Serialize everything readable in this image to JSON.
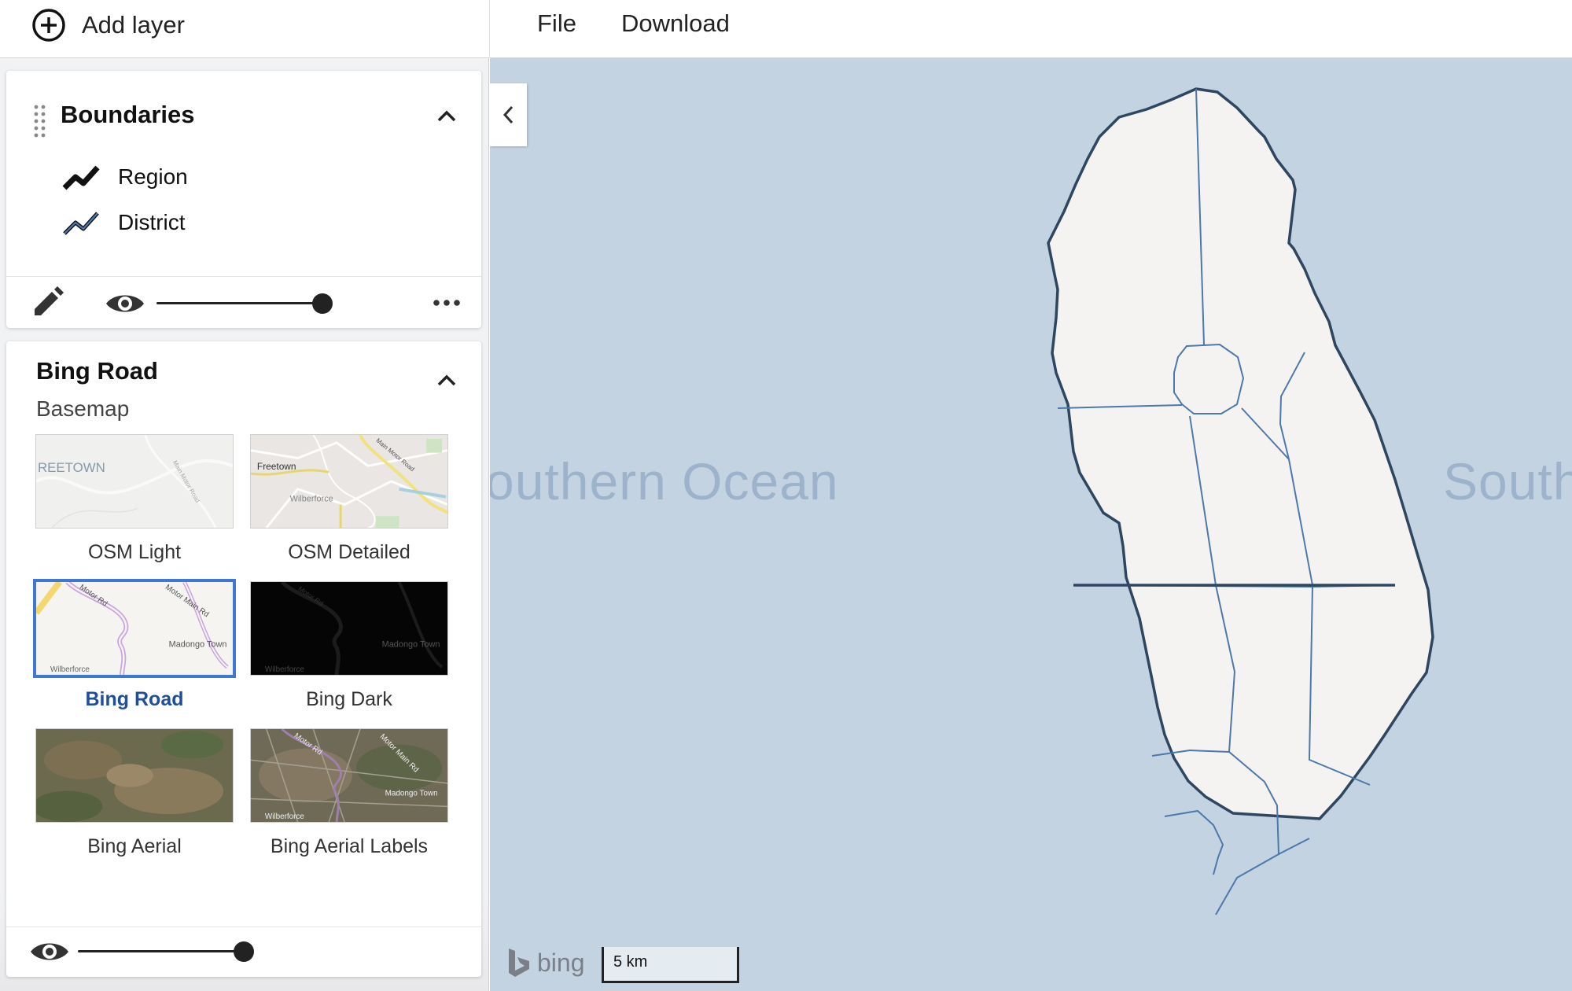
{
  "topbar": {
    "add_layer_label": "Add layer",
    "menu": [
      "File",
      "Download"
    ]
  },
  "layers": {
    "boundaries": {
      "title": "Boundaries",
      "legend": [
        {
          "label": "Region",
          "icon": "line-legend-icon",
          "color": "#111111"
        },
        {
          "label": "District",
          "icon": "line-legend-icon",
          "color": "#3f6fa8"
        }
      ],
      "opacity": 1.0
    },
    "basemap": {
      "title": "Bing Road",
      "subtitle": "Basemap",
      "options": [
        {
          "label": "OSM Light",
          "thumb_text": [
            "REETOWN",
            "Main Motor Road"
          ]
        },
        {
          "label": "OSM Detailed",
          "thumb_text": [
            "Freetown",
            "Wilberforce",
            "Main Motor Road"
          ]
        },
        {
          "label": "Bing Road",
          "thumb_text": [
            "Motor Rd",
            "Motor Main Rd",
            "Madongo Town",
            "Wilberforce"
          ]
        },
        {
          "label": "Bing Dark",
          "thumb_text": [
            "Motor Rd",
            "Madongo Town",
            "Wilberforce"
          ]
        },
        {
          "label": "Bing Aerial",
          "thumb_text": []
        },
        {
          "label": "Bing Aerial Labels",
          "thumb_text": [
            "Motor Rd",
            "Motor Main Rd",
            "Madongo Town",
            "Wilberforce"
          ]
        }
      ],
      "selected": "Bing Road",
      "opacity": 1.0
    }
  },
  "map": {
    "ocean_labels": [
      "outhern Ocean",
      "South"
    ],
    "attribution": "bing",
    "scale_label": "5 km",
    "colors": {
      "water": "#c4d3e1",
      "land": "#f5f3f1",
      "region_stroke": "#2e4660",
      "district_stroke": "#4c78ab"
    }
  }
}
